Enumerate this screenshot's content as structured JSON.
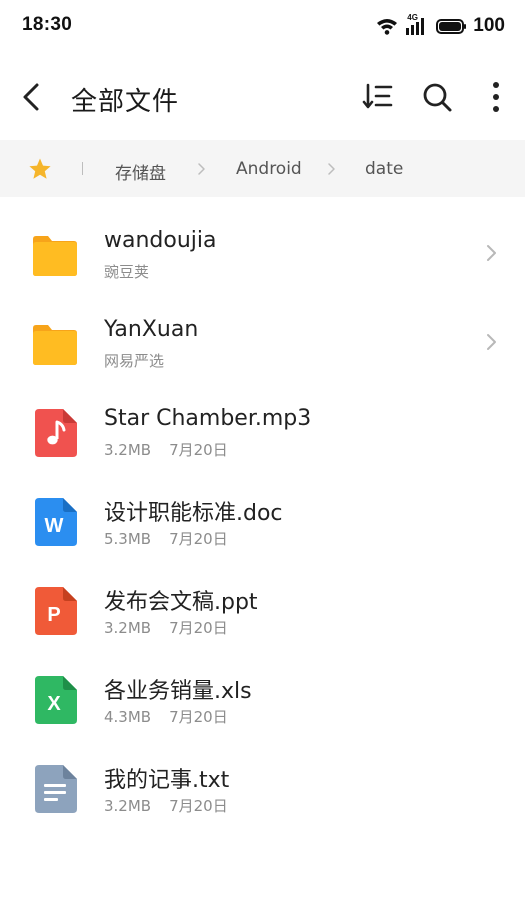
{
  "status_bar": {
    "time": "18:30",
    "network_label": "4G",
    "battery": "100",
    "icons": [
      "wifi-icon",
      "signal-4g-icon",
      "battery-icon"
    ]
  },
  "header": {
    "title": "全部文件",
    "icons": [
      "back-icon",
      "sort-icon",
      "search-icon",
      "more-icon"
    ]
  },
  "breadcrumb": {
    "icon": "star-icon",
    "star_color": "#f5b52b",
    "items": [
      "存储盘",
      "Android",
      "date"
    ]
  },
  "files": [
    {
      "name": "wandoujia",
      "subtitle": "豌豆荚",
      "type": "folder",
      "icon": "folder-icon",
      "color": "#ffb61e",
      "has_chevron": true
    },
    {
      "name": "YanXuan",
      "subtitle": "网易严选",
      "type": "folder",
      "icon": "folder-icon",
      "color": "#ffb61e",
      "has_chevron": true
    },
    {
      "name": "Star Chamber.mp3",
      "size": "3.2MB",
      "date": "7月20日",
      "type": "audio",
      "icon": "music-file-icon",
      "color": "#f0524f"
    },
    {
      "name": "设计职能标准.doc",
      "size": "5.3MB",
      "date": "7月20日",
      "type": "doc",
      "icon": "word-file-icon",
      "icon_letter": "W",
      "color": "#2b8ef0"
    },
    {
      "name": "发布会文稿.ppt",
      "size": "3.2MB",
      "date": "7月20日",
      "type": "ppt",
      "icon": "powerpoint-file-icon",
      "icon_letter": "P",
      "color": "#f05a38"
    },
    {
      "name": "各业务销量.xls",
      "size": "4.3MB",
      "date": "7月20日",
      "type": "xls",
      "icon": "excel-file-icon",
      "icon_letter": "X",
      "color": "#2fb863"
    },
    {
      "name": "我的记事.txt",
      "size": "3.2MB",
      "date": "7月20日",
      "type": "txt",
      "icon": "text-file-icon",
      "color": "#8da3bd"
    }
  ]
}
